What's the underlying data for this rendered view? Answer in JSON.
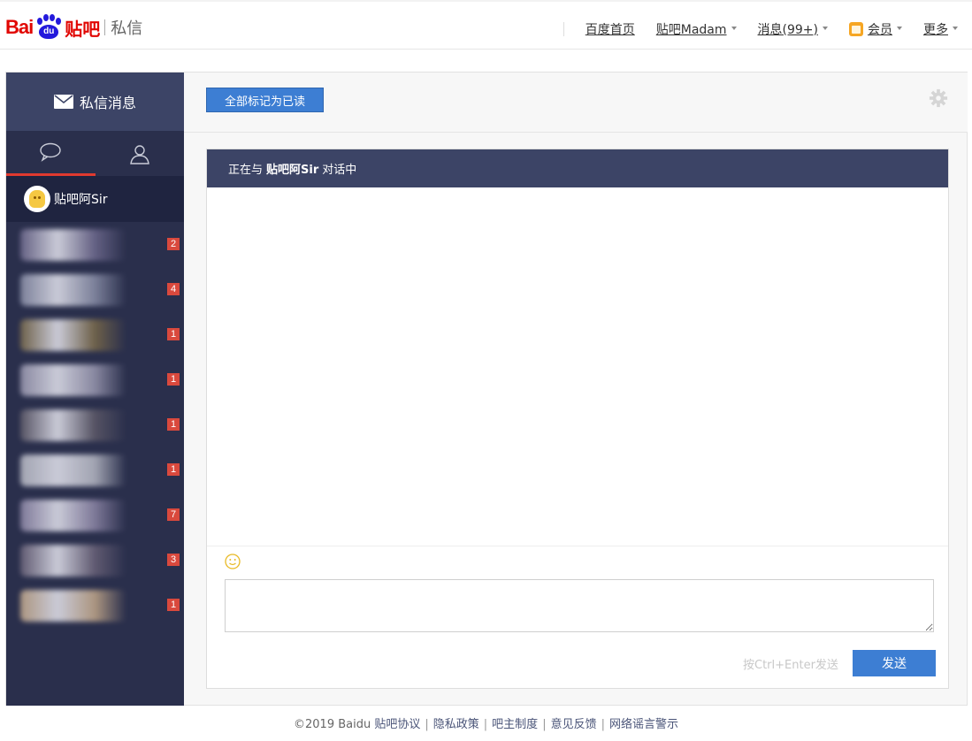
{
  "header": {
    "logo": {
      "bai": "Bai",
      "du": "du",
      "tieba": "贴吧",
      "sub": "私信"
    },
    "nav": [
      {
        "label": "百度首页",
        "caret": false,
        "name": "nav-baidu-home"
      },
      {
        "label": "贴吧Madam",
        "caret": true,
        "name": "nav-user-menu"
      },
      {
        "label": "消息(99+)",
        "caret": true,
        "name": "nav-messages"
      },
      {
        "label": "会员",
        "caret": true,
        "name": "nav-membership",
        "icon": "crown-icon"
      },
      {
        "label": "更多",
        "caret": true,
        "name": "nav-more"
      }
    ]
  },
  "sidebar": {
    "title": "私信消息",
    "tabs": [
      {
        "name": "conversations-tab",
        "icon": "chat-bubble-icon",
        "active": true
      },
      {
        "name": "contacts-tab",
        "icon": "person-icon",
        "active": false
      }
    ],
    "active_contact": {
      "name": "贴吧阿Sir"
    },
    "contacts": [
      {
        "unread": "2",
        "color": "#6f6a8e"
      },
      {
        "unread": "4",
        "color": "#8a8fa8"
      },
      {
        "unread": "1",
        "color": "#7a6a4a"
      },
      {
        "unread": "1",
        "color": "#9a98b0"
      },
      {
        "unread": "1",
        "color": "#5e5a68"
      },
      {
        "unread": "1",
        "color": "#b7b9c4"
      },
      {
        "unread": "7",
        "color": "#8d86a6"
      },
      {
        "unread": "3",
        "color": "#6a6278"
      },
      {
        "unread": "1",
        "color": "#c3a88a"
      }
    ]
  },
  "toolbar": {
    "mark_all_read": "全部标记为已读"
  },
  "chat": {
    "prefix": "正在与",
    "partner": "贴吧阿Sir",
    "suffix": "对话中",
    "hint": "按Ctrl+Enter发送",
    "send_label": "发送"
  },
  "footer": {
    "copyright": "©2019 Baidu",
    "links": [
      "贴吧协议",
      "隐私政策",
      "吧主制度",
      "意见反馈",
      "网络谣言警示"
    ]
  },
  "colors": {
    "brand_red": "#e10602",
    "brand_blue": "#2319dc",
    "sidebar_bg": "#2a2f4c",
    "header_panel": "#3c4466",
    "button_blue": "#3d7ed3",
    "badge_red": "#d9493d"
  }
}
